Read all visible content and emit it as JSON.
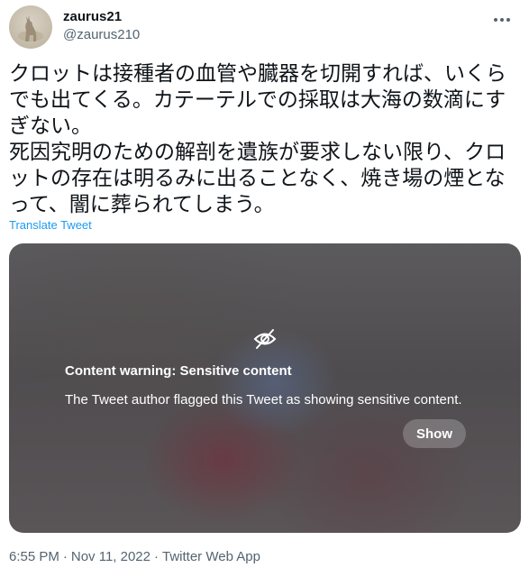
{
  "author": {
    "name": "zaurus21",
    "handle": "@zaurus210"
  },
  "more_icon": "more-horizontal-icon",
  "tweet": {
    "paragraphs": [
      "クロットは接種者の血管や臓器を切開すれば、いくらでも出てくる。カテーテルでの採取は大海の数滴にすぎない。",
      "死因究明のための解剖を遺族が要求しない限り、クロットの存在は明るみに出ることなく、焼き場の煙となって、闇に葬られてしまう。"
    ],
    "translate_label": "Translate Tweet"
  },
  "media": {
    "icon": "eye-slash-icon",
    "warning_title": "Content warning: Sensitive content",
    "warning_body": "The Tweet author flagged this Tweet as showing sensitive content.",
    "show_label": "Show"
  },
  "meta": {
    "time": "6:55 PM",
    "date": "Nov 11, 2022",
    "source": "Twitter Web App",
    "separator": "·"
  },
  "colors": {
    "link": "#1d9bf0",
    "secondary_text": "#536471",
    "text": "#0f1419"
  }
}
